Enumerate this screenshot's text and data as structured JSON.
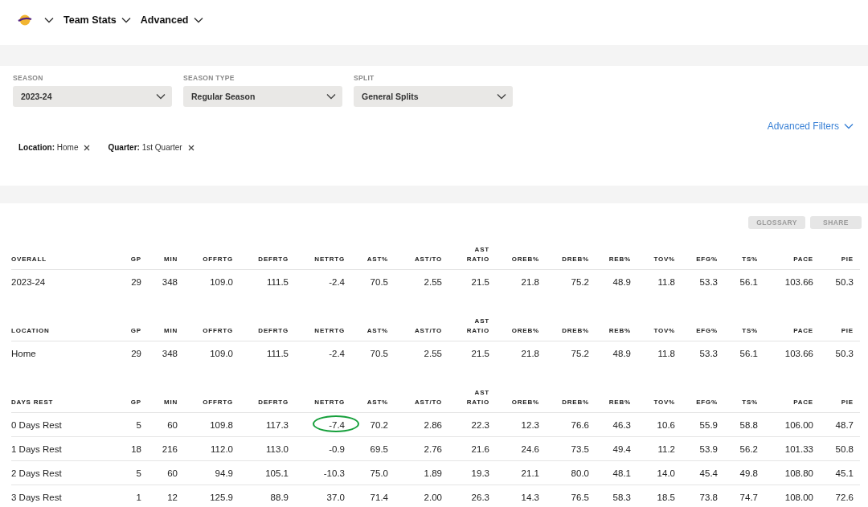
{
  "nav": [
    {
      "kind": "team"
    },
    {
      "kind": "menu",
      "label": "Team Stats"
    },
    {
      "kind": "menu",
      "label": "Advanced"
    }
  ],
  "filters": [
    {
      "label": "SEASON",
      "value": "2023-24"
    },
    {
      "label": "SEASON TYPE",
      "value": "Regular Season"
    },
    {
      "label": "SPLIT",
      "value": "General Splits"
    }
  ],
  "advanced_filters": "Advanced Filters",
  "chips": [
    {
      "key": "Location:",
      "value": "Home"
    },
    {
      "key": "Quarter:",
      "value": "1st Quarter"
    }
  ],
  "buttons": [
    "GLOSSARY",
    "SHARE"
  ],
  "sections": [
    {
      "title": "OVERALL",
      "columns": [
        "GP",
        "MIN",
        "OFFRTG",
        "DEFRTG",
        "NETRTG",
        "AST%",
        "AST/TO",
        "AST RATIO",
        "OREB%",
        "DREB%",
        "REB%",
        "TOV%",
        "EFG%",
        "TS%",
        "PACE",
        "PIE"
      ],
      "rows": [
        {
          "label": "2023-24",
          "cells": [
            "29",
            "348",
            "109.0",
            "111.5",
            "-2.4",
            "70.5",
            "2.55",
            "21.5",
            "21.8",
            "75.2",
            "48.9",
            "11.8",
            "53.3",
            "56.1",
            "103.66",
            "50.3"
          ]
        }
      ]
    },
    {
      "title": "LOCATION",
      "columns": [
        "GP",
        "MIN",
        "OFFRTG",
        "DEFRTG",
        "NETRTG",
        "AST%",
        "AST/TO",
        "AST RATIO",
        "OREB%",
        "DREB%",
        "REB%",
        "TOV%",
        "EFG%",
        "TS%",
        "PACE",
        "PIE"
      ],
      "rows": [
        {
          "label": "Home",
          "cells": [
            "29",
            "348",
            "109.0",
            "111.5",
            "-2.4",
            "70.5",
            "2.55",
            "21.5",
            "21.8",
            "75.2",
            "48.9",
            "11.8",
            "53.3",
            "56.1",
            "103.66",
            "50.3"
          ]
        }
      ]
    },
    {
      "title": "DAYS REST",
      "columns": [
        "GP",
        "MIN",
        "OFFRTG",
        "DEFRTG",
        "NETRTG",
        "AST%",
        "AST/TO",
        "AST RATIO",
        "OREB%",
        "DREB%",
        "REB%",
        "TOV%",
        "EFG%",
        "TS%",
        "PACE",
        "PIE"
      ],
      "rows": [
        {
          "label": "0 Days Rest",
          "cells": [
            "5",
            "60",
            "109.8",
            "117.3",
            "-7.4",
            "70.2",
            "2.86",
            "22.3",
            "12.3",
            "76.6",
            "46.3",
            "10.6",
            "55.9",
            "58.8",
            "106.00",
            "48.7"
          ],
          "circled": [
            false,
            false,
            false,
            false,
            true,
            false,
            false,
            false,
            false,
            false,
            false,
            false,
            false,
            false,
            false,
            false
          ]
        },
        {
          "label": "1 Days Rest",
          "cells": [
            "18",
            "216",
            "112.0",
            "113.0",
            "-0.9",
            "69.5",
            "2.76",
            "21.6",
            "24.6",
            "73.5",
            "49.4",
            "11.2",
            "53.9",
            "56.2",
            "101.33",
            "50.8"
          ]
        },
        {
          "label": "2 Days Rest",
          "cells": [
            "5",
            "60",
            "94.9",
            "105.1",
            "-10.3",
            "75.0",
            "1.89",
            "19.3",
            "21.1",
            "80.0",
            "48.1",
            "14.0",
            "45.4",
            "49.8",
            "108.80",
            "45.1"
          ]
        },
        {
          "label": "3 Days Rest",
          "cells": [
            "1",
            "12",
            "125.9",
            "88.9",
            "37.0",
            "71.4",
            "2.00",
            "26.3",
            "14.3",
            "76.5",
            "58.3",
            "18.5",
            "73.8",
            "74.7",
            "108.00",
            "72.6"
          ]
        }
      ]
    }
  ]
}
